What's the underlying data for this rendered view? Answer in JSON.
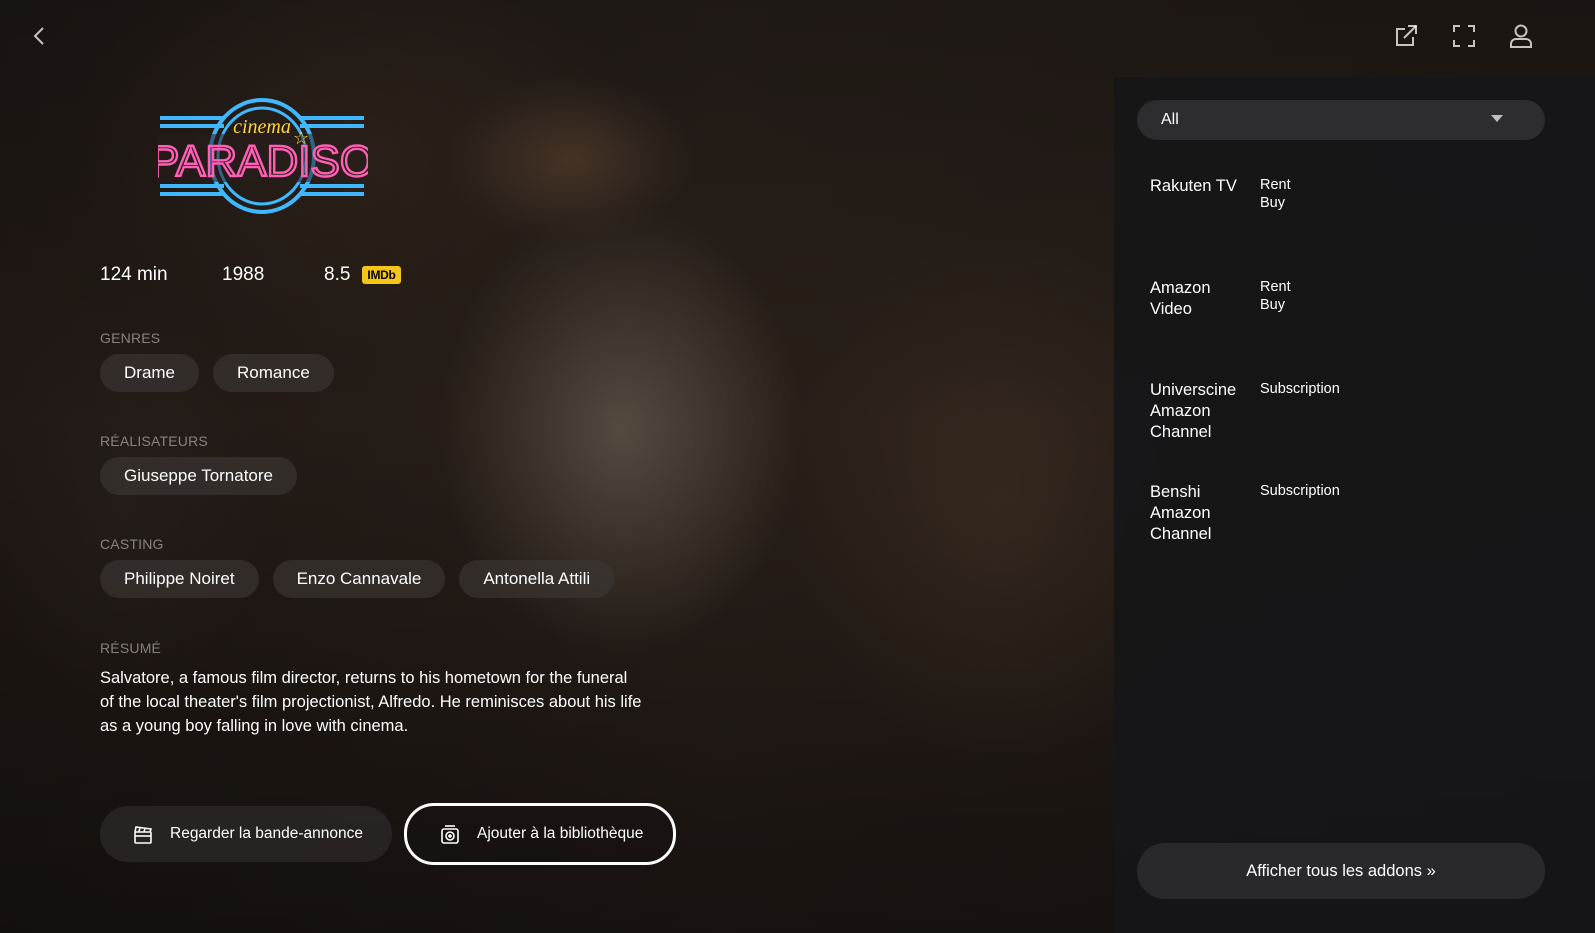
{
  "movie": {
    "logo_text_top": "cinema",
    "logo_text_main": "PARADISO",
    "runtime": "124 min",
    "year": "1988",
    "rating": "8.5",
    "rating_source": "IMDb",
    "genres_label": "GENRES",
    "genres": [
      "Drame",
      "Romance"
    ],
    "directors_label": "RÉALISATEURS",
    "directors": [
      "Giuseppe Tornatore"
    ],
    "cast_label": "CASTING",
    "cast": [
      "Philippe Noiret",
      "Enzo Cannavale",
      "Antonella Attili"
    ],
    "summary_label": "RÉSUMÉ",
    "summary": "Salvatore, a famous film director, returns to his hometown for the funeral of the local theater's film projectionist, Alfredo. He reminisces about his life as a young boy falling in love with cinema."
  },
  "actions": {
    "trailer_label": "Regarder la bande-annonce",
    "library_label": "Ajouter à la bibliothèque"
  },
  "streams": {
    "filter_value": "All",
    "items": [
      {
        "name": "Rakuten TV",
        "offers": [
          "Rent",
          "Buy"
        ]
      },
      {
        "name": "Amazon Video",
        "offers": [
          "Rent",
          "Buy"
        ]
      },
      {
        "name": "Universcine Amazon Channel",
        "offers": [
          "Subscription"
        ]
      },
      {
        "name": "Benshi Amazon Channel",
        "offers": [
          "Subscription"
        ]
      }
    ],
    "addons_label": "Afficher tous les addons »"
  },
  "colors": {
    "imdb": "#f5c518",
    "logo_pink": "#ff5fb4",
    "logo_cyan": "#3fb8ff",
    "logo_yellow": "#ffd43b"
  },
  "icons": {
    "back": "chevron-left-icon",
    "external": "external-link-icon",
    "fullscreen": "fullscreen-icon",
    "user": "user-icon",
    "trailer": "clapperboard-icon",
    "library": "add-to-library-icon"
  }
}
